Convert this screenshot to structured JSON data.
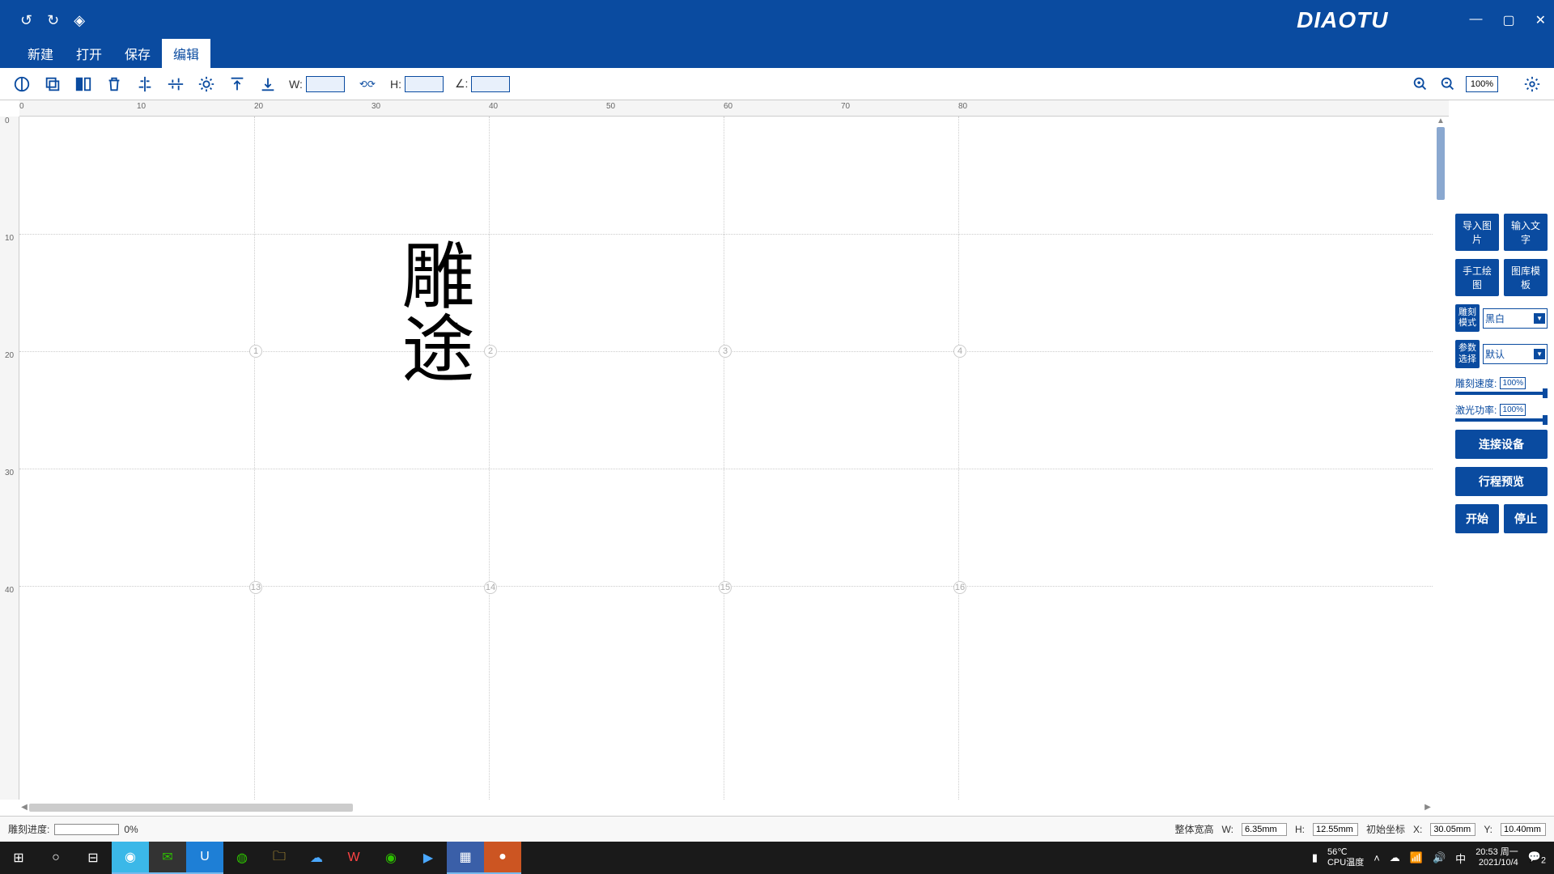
{
  "titlebar": {
    "logo": "DIAOTU"
  },
  "menu": {
    "new": "新建",
    "open": "打开",
    "save": "保存",
    "edit": "编辑"
  },
  "toolbar": {
    "w_label": "W:",
    "h_label": "H:",
    "angle_label": "∠:",
    "w_val": "",
    "h_val": "",
    "angle_val": "",
    "zoom": "100%"
  },
  "ruler_h": [
    "0",
    "10",
    "20",
    "30",
    "40",
    "50",
    "60",
    "70",
    "80"
  ],
  "ruler_v": [
    "0",
    "10",
    "20",
    "30",
    "40"
  ],
  "grid_nums_h": [
    "1",
    "2",
    "3",
    "4"
  ],
  "grid_nums_b": [
    "13",
    "14",
    "15",
    "16"
  ],
  "canvas_text": "雕途",
  "sidebar": {
    "import_img": "导入图片",
    "input_text": "输入文字",
    "hand_draw": "手工绘图",
    "gallery": "图库模板",
    "mode_label": "雕刻\n模式",
    "mode_val": "黑白",
    "param_label": "参数\n选择",
    "param_val": "默认",
    "speed_label": "雕刻速度:",
    "speed_val": "100%",
    "power_label": "激光功率:",
    "power_val": "100%",
    "connect": "连接设备",
    "preview": "行程预览",
    "start": "开始",
    "stop": "停止"
  },
  "status": {
    "progress_label": "雕刻进度:",
    "progress_pct": "0%",
    "overall_label": "整体宽高",
    "w_label": "W:",
    "w_val": "6.35mm",
    "h_label": "H:",
    "h_val": "12.55mm",
    "coord_label": "初始坐标",
    "x_label": "X:",
    "x_val": "30.05mm",
    "y_label": "Y:",
    "y_val": "10.40mm"
  },
  "taskbar": {
    "temp": "56℃",
    "temp_label": "CPU温度",
    "ime": "中",
    "time": "20:53 周一",
    "date": "2021/10/4",
    "notif": "2"
  }
}
